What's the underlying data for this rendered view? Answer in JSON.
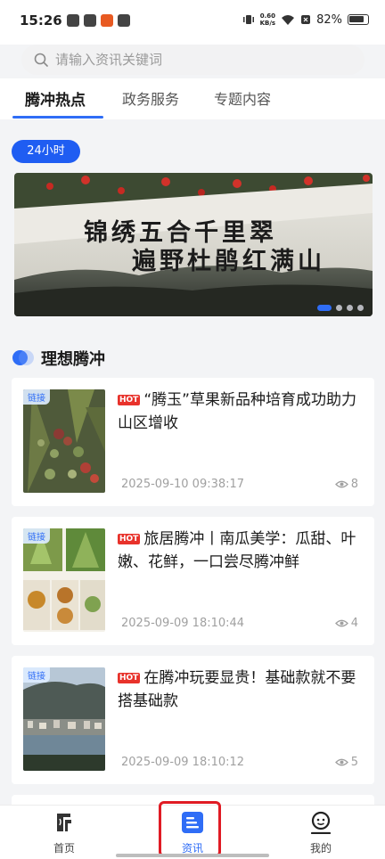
{
  "status_bar": {
    "time": "15:26",
    "net_speed": "0.60",
    "net_unit": "KB/s",
    "battery": "82%"
  },
  "search": {
    "placeholder": "请输入资讯关键词"
  },
  "tabs": [
    {
      "label": "腾冲热点",
      "active": true
    },
    {
      "label": "政务服务",
      "active": false
    },
    {
      "label": "专题内容",
      "active": false
    }
  ],
  "time_filter": "24小时",
  "banner": {
    "line1": "锦绣五合千里翠",
    "line2": "遍野杜鹃红满山",
    "pages": 4,
    "current_page": 1
  },
  "section": {
    "title": "理想腾冲"
  },
  "articles": [
    {
      "badge": "链接",
      "hot": "HOT",
      "title": "“腾玉”草果新品种培育成功助力山区增收",
      "time": "2025-09-10 09:38:17",
      "views": "8"
    },
    {
      "badge": "链接",
      "hot": "HOT",
      "title": "旅居腾冲丨南瓜美学：瓜甜、叶嫩、花鲜，一口尝尽腾冲鲜",
      "time": "2025-09-09 18:10:44",
      "views": "4"
    },
    {
      "badge": "链接",
      "hot": "HOT",
      "title": "在腾冲玩要显贵！基础款就不要搭基础款",
      "time": "2025-09-09 18:10:12",
      "views": "5"
    }
  ],
  "bottom_nav": [
    {
      "label": "首页",
      "icon": "home-logo-icon",
      "active": false
    },
    {
      "label": "资讯",
      "icon": "news-icon",
      "active": true
    },
    {
      "label": "我的",
      "icon": "profile-icon",
      "active": false
    }
  ],
  "colors": {
    "accent": "#2f6df6",
    "hot": "#e8322b",
    "highlight": "#e01b24"
  }
}
